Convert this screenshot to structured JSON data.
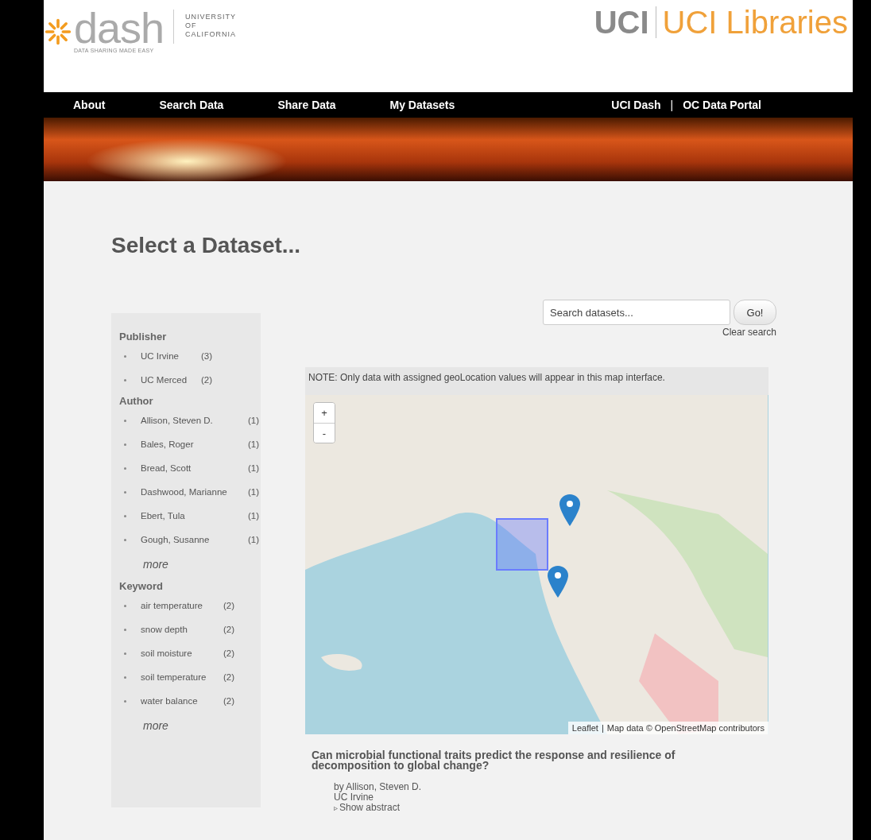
{
  "header": {
    "logo_text": "dash",
    "logo_tagline": "DATA SHARING MADE EASY",
    "university": [
      "UNIVERSITY",
      "OF",
      "CALIFORNIA"
    ],
    "uci_mark": "UCI",
    "libraries": "UCI Libraries"
  },
  "nav": {
    "items": [
      {
        "label": "About"
      },
      {
        "label": "Search Data"
      },
      {
        "label": "Share Data"
      },
      {
        "label": "My Datasets"
      }
    ],
    "right": [
      {
        "label": "UCI Dash"
      },
      {
        "label": "OC Data Portal"
      }
    ],
    "separator": "|"
  },
  "page_title": "Select a Dataset...",
  "facets": [
    {
      "title": "Publisher",
      "items": [
        {
          "label": "UC Irvine",
          "count": "(3)"
        },
        {
          "label": "UC Merced",
          "count": "(2)"
        }
      ]
    },
    {
      "title": "Author",
      "items": [
        {
          "label": "Allison, Steven D.",
          "count": "(1)"
        },
        {
          "label": "Bales, Roger",
          "count": "(1)"
        },
        {
          "label": "Bread, Scott",
          "count": "(1)"
        },
        {
          "label": "Dashwood, Marianne",
          "count": "(1)"
        },
        {
          "label": "Ebert, Tula",
          "count": "(1)"
        },
        {
          "label": "Gough, Susanne",
          "count": "(1)"
        }
      ],
      "more": "more"
    },
    {
      "title": "Keyword",
      "items": [
        {
          "label": "air temperature",
          "count": "(2)"
        },
        {
          "label": "snow depth",
          "count": "(2)"
        },
        {
          "label": "soil moisture",
          "count": "(2)"
        },
        {
          "label": "soil temperature",
          "count": "(2)"
        },
        {
          "label": "water balance",
          "count": "(2)"
        }
      ],
      "more": "more"
    }
  ],
  "search": {
    "placeholder": "Search datasets...",
    "button": "Go!",
    "clear": "Clear search"
  },
  "map": {
    "note": "NOTE: Only data with assigned geoLocation values will appear in this map interface.",
    "zoom_in": "+",
    "zoom_out": "-",
    "attribution_link": "Leaflet",
    "attribution_sep": "|",
    "attribution": "Map data © OpenStreetMap contributors"
  },
  "results": [
    {
      "title": "Can microbial functional traits predict the response and resilience of decomposition to global change?",
      "author": "by Allison, Steven D.",
      "publisher": "UC Irvine",
      "toggle_icon": "▹",
      "toggle": "Show abstract"
    }
  ]
}
